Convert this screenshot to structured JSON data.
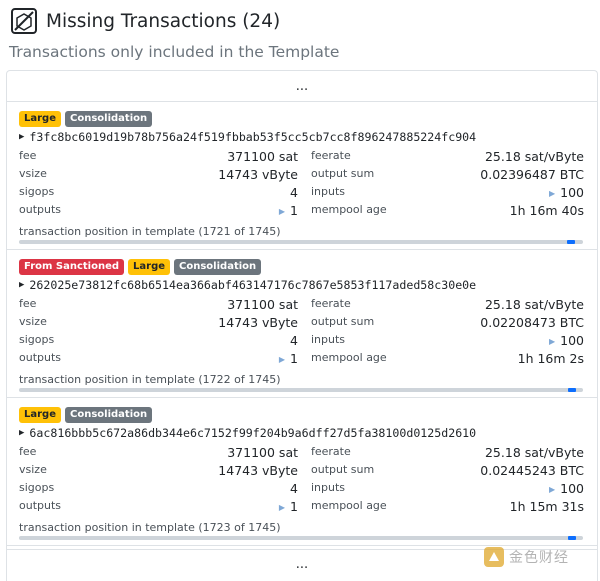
{
  "header": {
    "title": "Missing Transactions (24)",
    "subtitle": "Transactions only included in the Template"
  },
  "ellipsis_top": "...",
  "ellipsis_bottom": "...",
  "labels": {
    "fee": "fee",
    "vsize": "vsize",
    "sigops": "sigops",
    "outputs": "outputs",
    "feerate": "feerate",
    "output_sum": "output sum",
    "inputs": "inputs",
    "mempool_age": "mempool age"
  },
  "transactions": [
    {
      "tags": [
        "Large",
        "Consolidation"
      ],
      "txid": "f3fc8bc6019d19b78b756a24f519fbbab53f5cc5cb7cc8f896247885224fc904",
      "fee": "371100 sat",
      "vsize": "14743 vByte",
      "sigops": "4",
      "outputs": "1",
      "feerate": "25.18 sat/vByte",
      "output_sum": "0.02396487 BTC",
      "inputs": "100",
      "mempool_age": "1h 16m 40s",
      "position_text": "transaction position in template (1721 of 1745)",
      "position": 1721,
      "total": 1745
    },
    {
      "tags": [
        "From Sanctioned",
        "Large",
        "Consolidation"
      ],
      "txid": "262025e73812fc68b6514ea366abf463147176c7867e5853f117aded58c30e0e",
      "fee": "371100 sat",
      "vsize": "14743 vByte",
      "sigops": "4",
      "outputs": "1",
      "feerate": "25.18 sat/vByte",
      "output_sum": "0.02208473 BTC",
      "inputs": "100",
      "mempool_age": "1h 16m 2s",
      "position_text": "transaction position in template (1722 of 1745)",
      "position": 1722,
      "total": 1745
    },
    {
      "tags": [
        "Large",
        "Consolidation"
      ],
      "txid": "6ac816bbb5c672a86db344e6c7152f99f204b9a6dff27d5fa38100d0125d2610",
      "fee": "371100 sat",
      "vsize": "14743 vByte",
      "sigops": "4",
      "outputs": "1",
      "feerate": "25.18 sat/vByte",
      "output_sum": "0.02445243 BTC",
      "inputs": "100",
      "mempool_age": "1h 15m 31s",
      "position_text": "transaction position in template (1723 of 1745)",
      "position": 1723,
      "total": 1745
    }
  ],
  "watermark": {
    "text": "金色财经"
  },
  "colors": {
    "large": "#ffc107",
    "consolidation": "#6c757d",
    "sanctioned": "#dc3545",
    "position_marker": "#0d6efd"
  }
}
